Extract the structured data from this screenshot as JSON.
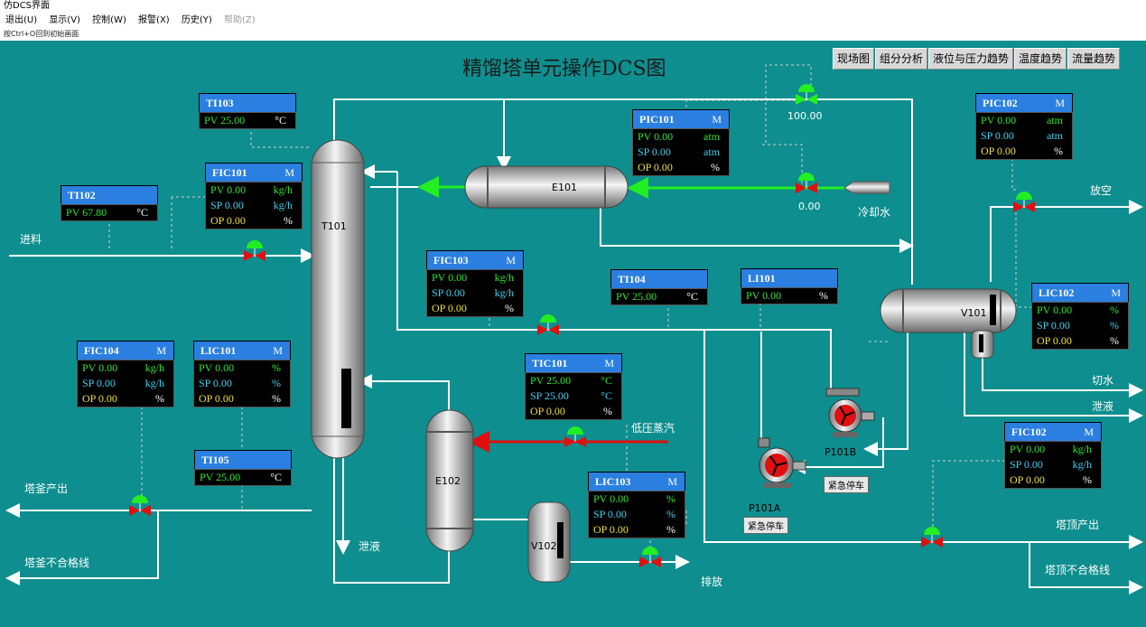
{
  "window": {
    "title": "仿DCS界面"
  },
  "menu": [
    {
      "label": "退出(U)",
      "disabled": false
    },
    {
      "label": "显示(V)",
      "disabled": false
    },
    {
      "label": "控制(W)",
      "disabled": false
    },
    {
      "label": "报警(X)",
      "disabled": false
    },
    {
      "label": "历史(Y)",
      "disabled": false
    },
    {
      "label": "帮助(Z)",
      "disabled": true
    }
  ],
  "hint": "按Ctrl+O回到初始画面",
  "page_title": "精馏塔单元操作DCS图",
  "tabs": [
    "现场图",
    "组分分析",
    "液位与压力趋势",
    "温度趋势",
    "流量趋势"
  ],
  "equipment": {
    "T101": "T101",
    "E101": "E101",
    "E102": "E102",
    "V101": "V101",
    "V102": "V102",
    "P101A": "P101A",
    "P101B": "P101B"
  },
  "labels": {
    "feed": "进料",
    "cooling_water": "冷却水",
    "vent": "放空",
    "water_cut": "切水",
    "drain_right": "泄液",
    "low_pressure_steam": "低压蒸汽",
    "drain_left": "泄液",
    "bottom_product": "塔釜产出",
    "bottom_offspec": "塔釜不合格线",
    "discharge": "排放",
    "top_product": "塔顶产出",
    "top_offspec": "塔顶不合格线",
    "valve_top": "100.00",
    "valve_cw": "0.00"
  },
  "buttons": {
    "stop_a": "紧急停车",
    "stop_b": "紧急停车"
  },
  "instruments": {
    "TI103": {
      "tag": "TI103",
      "pv": "PV 25.00",
      "pv_unit": "°C"
    },
    "TI102": {
      "tag": "TI102",
      "pv": "PV 67.80",
      "pv_unit": "°C"
    },
    "TI104": {
      "tag": "TI104",
      "pv": "PV 25.00",
      "pv_unit": "°C"
    },
    "TI105": {
      "tag": "TI105",
      "pv": "PV 25.00",
      "pv_unit": "°C"
    },
    "LI101": {
      "tag": "LI101",
      "pv": "PV 0.00",
      "pv_unit": "%"
    },
    "FIC101": {
      "tag": "FIC101",
      "mode": "M",
      "pv": "PV 0.00",
      "pv_unit": "kg/h",
      "sp": "SP 0.00",
      "sp_unit": "kg/h",
      "op": "OP 0.00",
      "op_unit": "%"
    },
    "FIC103": {
      "tag": "FIC103",
      "mode": "M",
      "pv": "PV 0.00",
      "pv_unit": "kg/h",
      "sp": "SP 0.00",
      "sp_unit": "kg/h",
      "op": "OP 0.00",
      "op_unit": "%"
    },
    "FIC104": {
      "tag": "FIC104",
      "mode": "M",
      "pv": "PV 0.00",
      "pv_unit": "kg/h",
      "sp": "SP 0.00",
      "sp_unit": "kg/h",
      "op": "OP 0.00",
      "op_unit": "%"
    },
    "FIC102": {
      "tag": "FIC102",
      "mode": "M",
      "pv": "PV 0.00",
      "pv_unit": "kg/h",
      "sp": "SP 0.00",
      "sp_unit": "kg/h",
      "op": "OP 0.00",
      "op_unit": "%"
    },
    "LIC101": {
      "tag": "LIC101",
      "mode": "M",
      "pv": "PV 0.00",
      "pv_unit": "%",
      "sp": "SP 0.00",
      "sp_unit": "%",
      "op": "OP 0.00",
      "op_unit": "%"
    },
    "LIC102": {
      "tag": "LIC102",
      "mode": "M",
      "pv": "PV 0.00",
      "pv_unit": "%",
      "sp": "SP 0.00",
      "sp_unit": "%",
      "op": "OP 0.00",
      "op_unit": "%"
    },
    "LIC103": {
      "tag": "LIC103",
      "mode": "M",
      "pv": "PV 0.00",
      "pv_unit": "%",
      "sp": "SP 0.00",
      "sp_unit": "%",
      "op": "OP 0.00",
      "op_unit": "%"
    },
    "PIC101": {
      "tag": "PIC101",
      "mode": "M",
      "pv": "PV 0.00",
      "pv_unit": "atm",
      "sp": "SP 0.00",
      "sp_unit": "atm",
      "op": "OP 0.00",
      "op_unit": "%"
    },
    "PIC102": {
      "tag": "PIC102",
      "mode": "M",
      "pv": "PV 0.00",
      "pv_unit": "atm",
      "sp": "SP 0.00",
      "sp_unit": "atm",
      "op": "OP 0.00",
      "op_unit": "%"
    },
    "TIC101": {
      "tag": "TIC101",
      "mode": "M",
      "pv": "PV 25.00",
      "pv_unit": "°C",
      "sp": "SP 25.00",
      "sp_unit": "°C",
      "op": "OP 0.00",
      "op_unit": "%"
    }
  },
  "colors": {
    "background": "#0e8e8e",
    "pipe": "#ffffff",
    "cooling_water_pipe": "#22ee22",
    "steam_pipe": "#e01010",
    "header": "#2a7fe0"
  }
}
